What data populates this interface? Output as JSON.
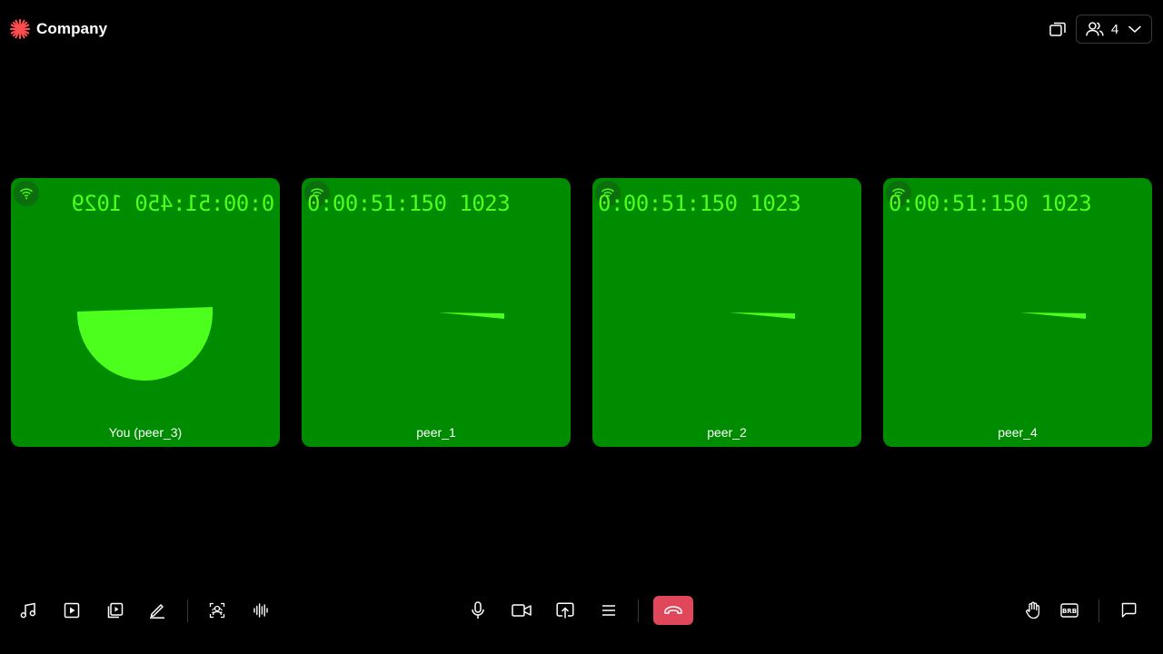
{
  "header": {
    "brand_name": "Company",
    "participants_count": "4",
    "accent_color": "#ff4d4d"
  },
  "tiles": [
    {
      "name": "You (peer_3)",
      "timecode": "0:00:51:450 1029",
      "mirrored": true
    },
    {
      "name": "peer_1",
      "timecode": "0:00:51:150 1023",
      "mirrored": false
    },
    {
      "name": "peer_2",
      "timecode": "0:00:51:150 1023",
      "mirrored": false
    },
    {
      "name": "peer_4",
      "timecode": "0:00:51:150 1023",
      "mirrored": false
    }
  ],
  "colors": {
    "tile_background": "#008c00",
    "timecode": "#4cff1c",
    "leave_button": "#e0475a"
  },
  "toolbar": {
    "left": [
      "music-icon",
      "video-play-icon",
      "media-playlist-icon",
      "pen-icon",
      "virtual-background-icon",
      "audio-waveform-icon"
    ],
    "center": [
      "microphone-icon",
      "camera-icon",
      "screen-share-icon",
      "menu-icon",
      "leave-call-icon"
    ],
    "right": [
      "raise-hand-icon",
      "brb-icon",
      "chat-icon"
    ]
  }
}
